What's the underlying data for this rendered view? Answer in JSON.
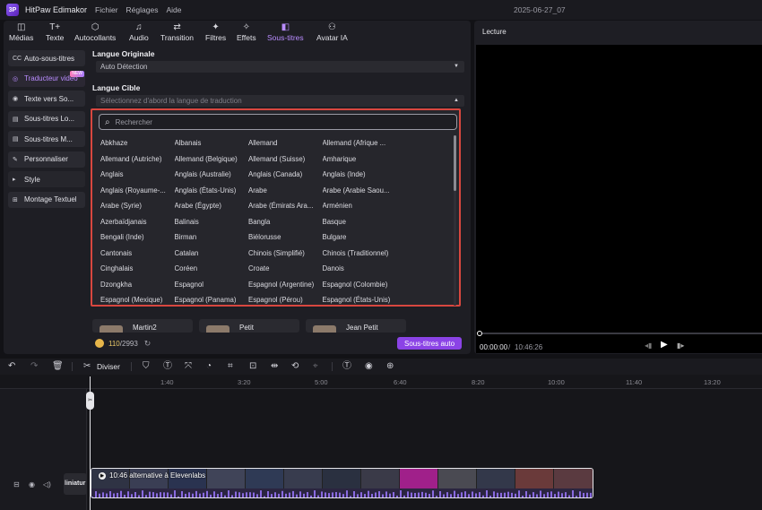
{
  "app": {
    "title": "HitPaw Edimakor",
    "logo_text": "3P",
    "menu": [
      "Fichier",
      "Réglages",
      "Aide"
    ],
    "project_name": "2025-06-27_07"
  },
  "toolbar": [
    {
      "icon": "◫",
      "label": "Médias"
    },
    {
      "icon": "T+",
      "label": "Texte"
    },
    {
      "icon": "⬡",
      "label": "Autocollants"
    },
    {
      "icon": "♫",
      "label": "Audio"
    },
    {
      "icon": "⇄",
      "label": "Transition"
    },
    {
      "icon": "✦",
      "label": "Filtres"
    },
    {
      "icon": "✧",
      "label": "Effets"
    },
    {
      "icon": "◧",
      "label": "Sous-titres"
    },
    {
      "icon": "⚇",
      "label": "Avatar IA"
    }
  ],
  "sidebar": [
    {
      "icon": "CC",
      "label": "Auto-sous-titres"
    },
    {
      "icon": "◎",
      "label": "Traducteur vidéo",
      "badge": "NEW"
    },
    {
      "icon": "◉",
      "label": "Texte vers So..."
    },
    {
      "icon": "▤",
      "label": "Sous-titres Lo..."
    },
    {
      "icon": "▤",
      "label": "Sous-titres M..."
    },
    {
      "icon": "✎",
      "label": "Personnaliser"
    },
    {
      "icon": "▸",
      "label": "Style"
    },
    {
      "icon": "⊞",
      "label": "Montage Textuel"
    }
  ],
  "source": {
    "label": "Langue Originale",
    "value": "Auto Détection"
  },
  "target": {
    "label": "Langue Cible",
    "placeholder": "Sélectionnez d'abord la langue de traduction"
  },
  "search": {
    "placeholder": "Rechercher"
  },
  "languages": [
    [
      "Abkhaze",
      "Albanais",
      "Allemand",
      "Allemand (Afrique ..."
    ],
    [
      "Allemand (Autriche)",
      "Allemand (Belgique)",
      "Allemand (Suisse)",
      "Amharique"
    ],
    [
      "Anglais",
      "Anglais (Australie)",
      "Anglais (Canada)",
      "Anglais (Inde)"
    ],
    [
      "Anglais (Royaume-...",
      "Anglais (États-Unis)",
      "Arabe",
      "Arabe (Arabie Saou..."
    ],
    [
      "Arabe (Syrie)",
      "Arabe (Égypte)",
      "Arabe (Émirats Ara...",
      "Arménien"
    ],
    [
      "Azerbaïdjanais",
      "Balinais",
      "Bangla",
      "Basque"
    ],
    [
      "Bengali (Inde)",
      "Birman",
      "Biélorusse",
      "Bulgare"
    ],
    [
      "Cantonais",
      "Catalan",
      "Chinois (Simplifié)",
      "Chinois (Traditionnel)"
    ],
    [
      "Cinghalais",
      "Coréen",
      "Croate",
      "Danois"
    ],
    [
      "Dzongkha",
      "Espagnol",
      "Espagnol (Argentine)",
      "Espagnol (Colombie)"
    ],
    [
      "Espagnol (Mexique)",
      "Espagnol (Panama)",
      "Espagnol (Pérou)",
      "Espagnol (États-Unis)"
    ]
  ],
  "voices": [
    "Martin2",
    "Petit",
    "Jean Petit"
  ],
  "credits": {
    "used": "110",
    "total": "/2993"
  },
  "auto_button": "Sous-titres auto",
  "preview": {
    "title": "Lecture",
    "time_current": "00:00:00",
    "time_sep": "/",
    "time_total": "10:46:26"
  },
  "timeline": {
    "split_label": "Diviser",
    "ticks": [
      "1:40",
      "3:20",
      "5:00",
      "6:40",
      "8:20",
      "10:00",
      "11:40",
      "13:20"
    ],
    "track_name": "liniatur",
    "clip_title": "10:46 alternative à Elevenlabs"
  },
  "colors": {
    "accent": "#b98cff",
    "button": "#8b43e6",
    "dropdown_border": "#d8473f"
  }
}
